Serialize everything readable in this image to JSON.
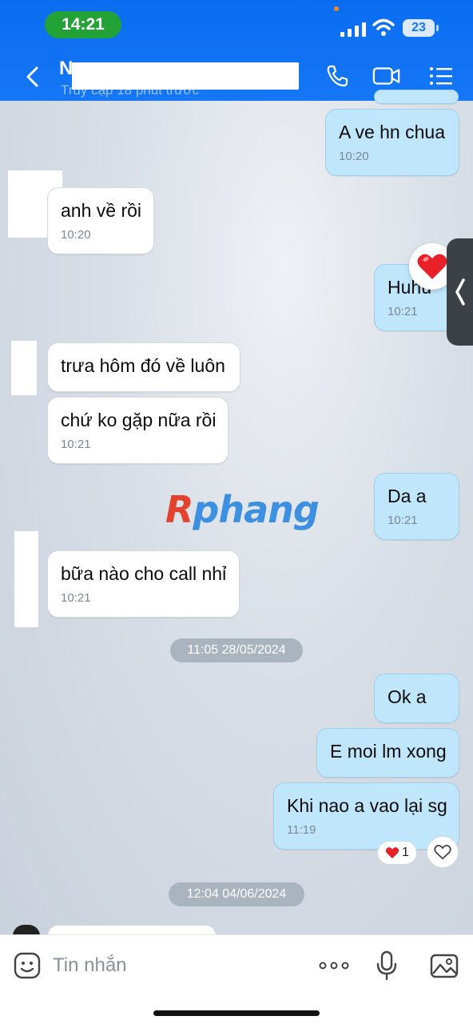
{
  "status_bar": {
    "time": "14:21",
    "battery": "23"
  },
  "header": {
    "contact_name": "N",
    "last_seen": "Truy cập 18 phút trước"
  },
  "messages": [
    {
      "text": "A ve hn chua",
      "time": "10:20",
      "side": "out"
    },
    {
      "text": "anh về rồi",
      "time": "10:20",
      "side": "in"
    },
    {
      "text": "Huhu",
      "time": "10:21",
      "side": "out"
    },
    {
      "text": "trưa hôm đó về luôn",
      "time": "",
      "side": "in"
    },
    {
      "text": "chứ ko gặp nữa rồi",
      "time": "10:21",
      "side": "in"
    },
    {
      "text": "Da a",
      "time": "10:21",
      "side": "out"
    },
    {
      "text": "bữa nào cho call nhỉ",
      "time": "10:21",
      "side": "in"
    },
    {
      "text": "Ok a",
      "time": "",
      "side": "out"
    },
    {
      "text": "E moi lm xong",
      "time": "",
      "side": "out"
    },
    {
      "text": "Khi nao a vao lại sg",
      "time": "11:19",
      "side": "out"
    }
  ],
  "date_separators": [
    "11:05 28/05/2024",
    "12:04 04/06/2024"
  ],
  "reaction": {
    "emoji": "heart",
    "count": "1"
  },
  "watermark": {
    "first": "R",
    "rest": "phang"
  },
  "input": {
    "placeholder": "Tin nhắn"
  },
  "colors": {
    "header_blue": "#1577f5",
    "outgoing_bubble": "#bfe6fb",
    "incoming_bubble": "#ffffff",
    "status_green": "#23a238",
    "heart_red": "#e8202a"
  },
  "icons": [
    "back-icon",
    "phone-icon",
    "video-call-icon",
    "menu-list-icon",
    "heart-icon",
    "chevron-left-icon",
    "sticker-icon",
    "more-icon",
    "microphone-icon",
    "image-icon"
  ]
}
